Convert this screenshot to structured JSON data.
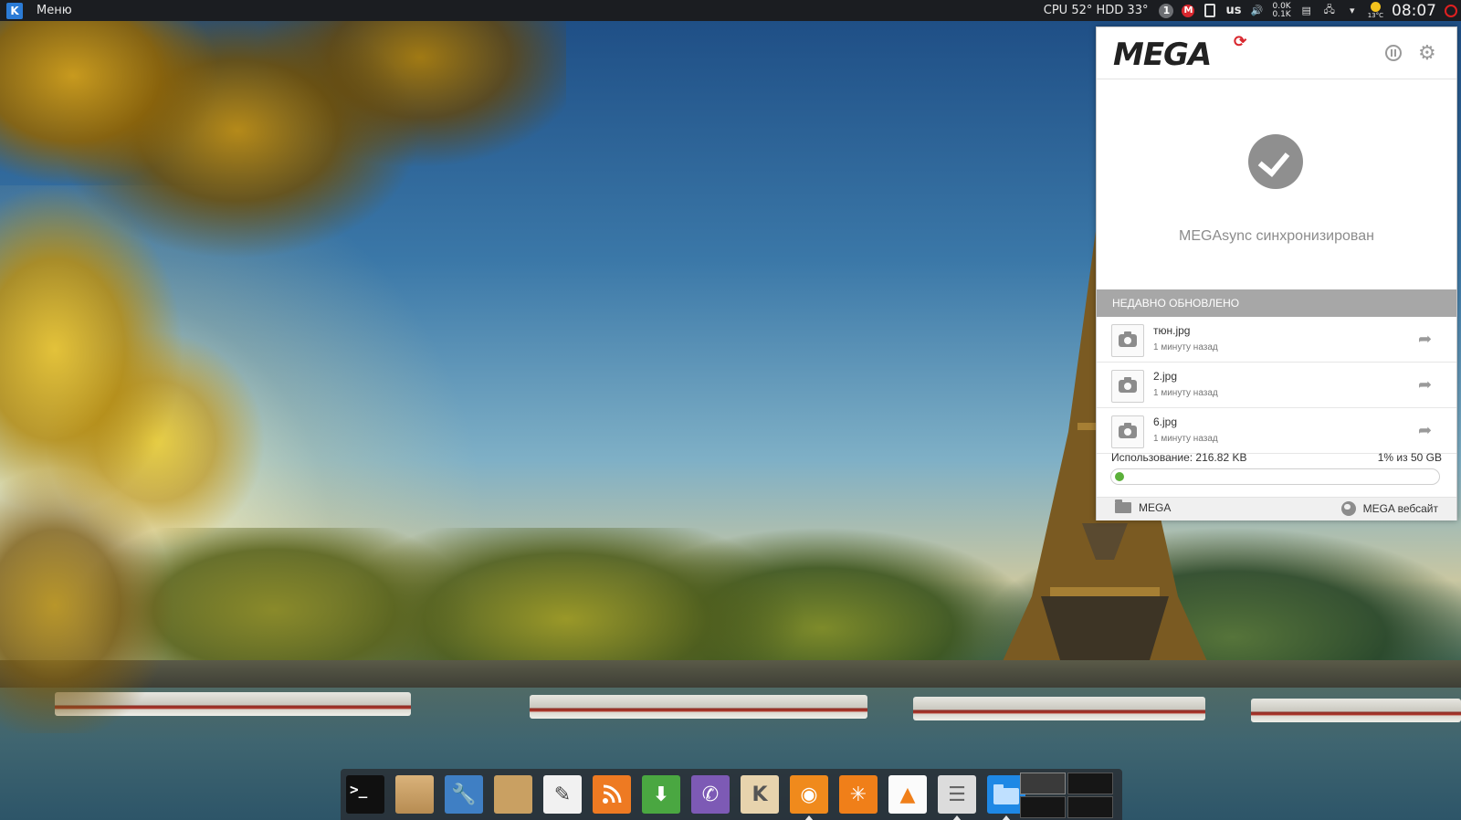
{
  "top_panel": {
    "menu_label": "Меню",
    "sysmon": "CPU 52° HDD 33°",
    "info_badge": "1",
    "mega_badge": "M",
    "keyboard_layout": "us",
    "net_down": "0.0K",
    "net_up": "0.1K",
    "weather_temp": "13°C",
    "clock": "08:07"
  },
  "mega": {
    "logo": "MEGA",
    "status_text": "MEGAsync синхронизирован",
    "recent_header": "НЕДАВНО ОБНОВЛЕНО",
    "files": [
      {
        "name": "тюн.jpg",
        "time": "1 минуту назад"
      },
      {
        "name": "2.jpg",
        "time": "1 минуту назад"
      },
      {
        "name": "6.jpg",
        "time": "1 минуту назад"
      }
    ],
    "usage_label": "Использование: 216.82 KB",
    "usage_total": "1% из 50 GB",
    "usage_fraction": 0.01,
    "footer_left": "MEGA",
    "footer_right": "MEGA вебсайт"
  },
  "dock": {
    "items": [
      {
        "name": "terminal-icon",
        "glyph": ">_",
        "running": false
      },
      {
        "name": "package-manager-icon",
        "glyph": "",
        "running": false
      },
      {
        "name": "system-tools-icon",
        "glyph": "🔧",
        "running": false
      },
      {
        "name": "gimp-icon",
        "glyph": "",
        "running": false
      },
      {
        "name": "text-editor-icon",
        "glyph": "✎",
        "running": false
      },
      {
        "name": "rss-icon",
        "glyph": "",
        "running": false
      },
      {
        "name": "download-manager-icon",
        "glyph": "⬇",
        "running": false
      },
      {
        "name": "viber-icon",
        "glyph": "✆",
        "running": false
      },
      {
        "name": "mail-client-icon",
        "glyph": "K",
        "running": false
      },
      {
        "name": "eye-app-icon",
        "glyph": "◉",
        "running": true
      },
      {
        "name": "orange-app-icon",
        "glyph": "✳",
        "running": false
      },
      {
        "name": "vlc-icon",
        "glyph": "▲",
        "running": false
      },
      {
        "name": "file-cabinet-icon",
        "glyph": "☰",
        "running": true
      },
      {
        "name": "file-manager-icon",
        "glyph": "",
        "running": true
      }
    ]
  },
  "colors": {
    "panel_bg": "#1b1d21",
    "mega_red": "#d9272e",
    "usage_green": "#5bb03a",
    "recent_header_bg": "#a7a7a7"
  }
}
